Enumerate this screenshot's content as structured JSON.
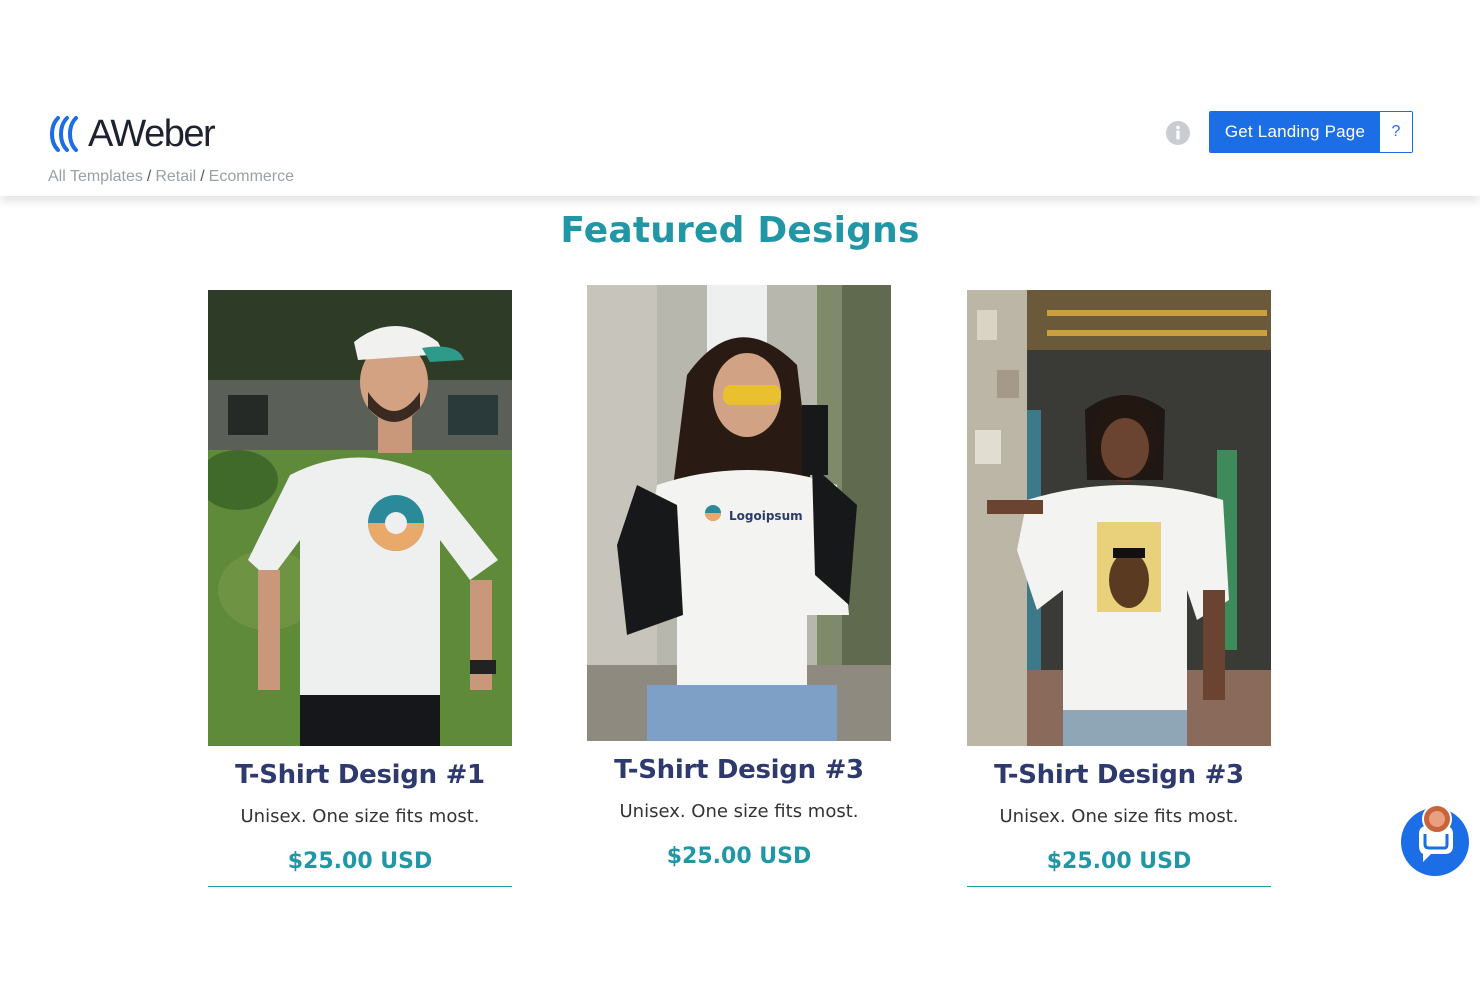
{
  "brand": {
    "logo_text": "AWeber",
    "primary_color": "#1b6ee6",
    "accent_color": "#2197a6"
  },
  "breadcrumb": [
    {
      "label": "All Templates"
    },
    {
      "label": "Retail"
    },
    {
      "label": "Ecommerce"
    }
  ],
  "header": {
    "info_icon": "info-icon",
    "cta_label": "Get Landing Page",
    "help_label": "?"
  },
  "main": {
    "title": "Featured Designs",
    "products": [
      {
        "name": "T-Shirt Design #1",
        "description": "Unisex. One size fits most.",
        "price": "$25.00 USD",
        "shirt_graphic": "circle-logo"
      },
      {
        "name": "T-Shirt Design #3",
        "description": "Unisex. One size fits most.",
        "price": "$25.00 USD",
        "shirt_graphic": "Logoipsum"
      },
      {
        "name": "T-Shirt Design #3",
        "description": "Unisex. One size fits most.",
        "price": "$25.00 USD",
        "shirt_graphic": "dog-print"
      }
    ]
  },
  "chat": {
    "icon": "chat-bubble-icon"
  }
}
